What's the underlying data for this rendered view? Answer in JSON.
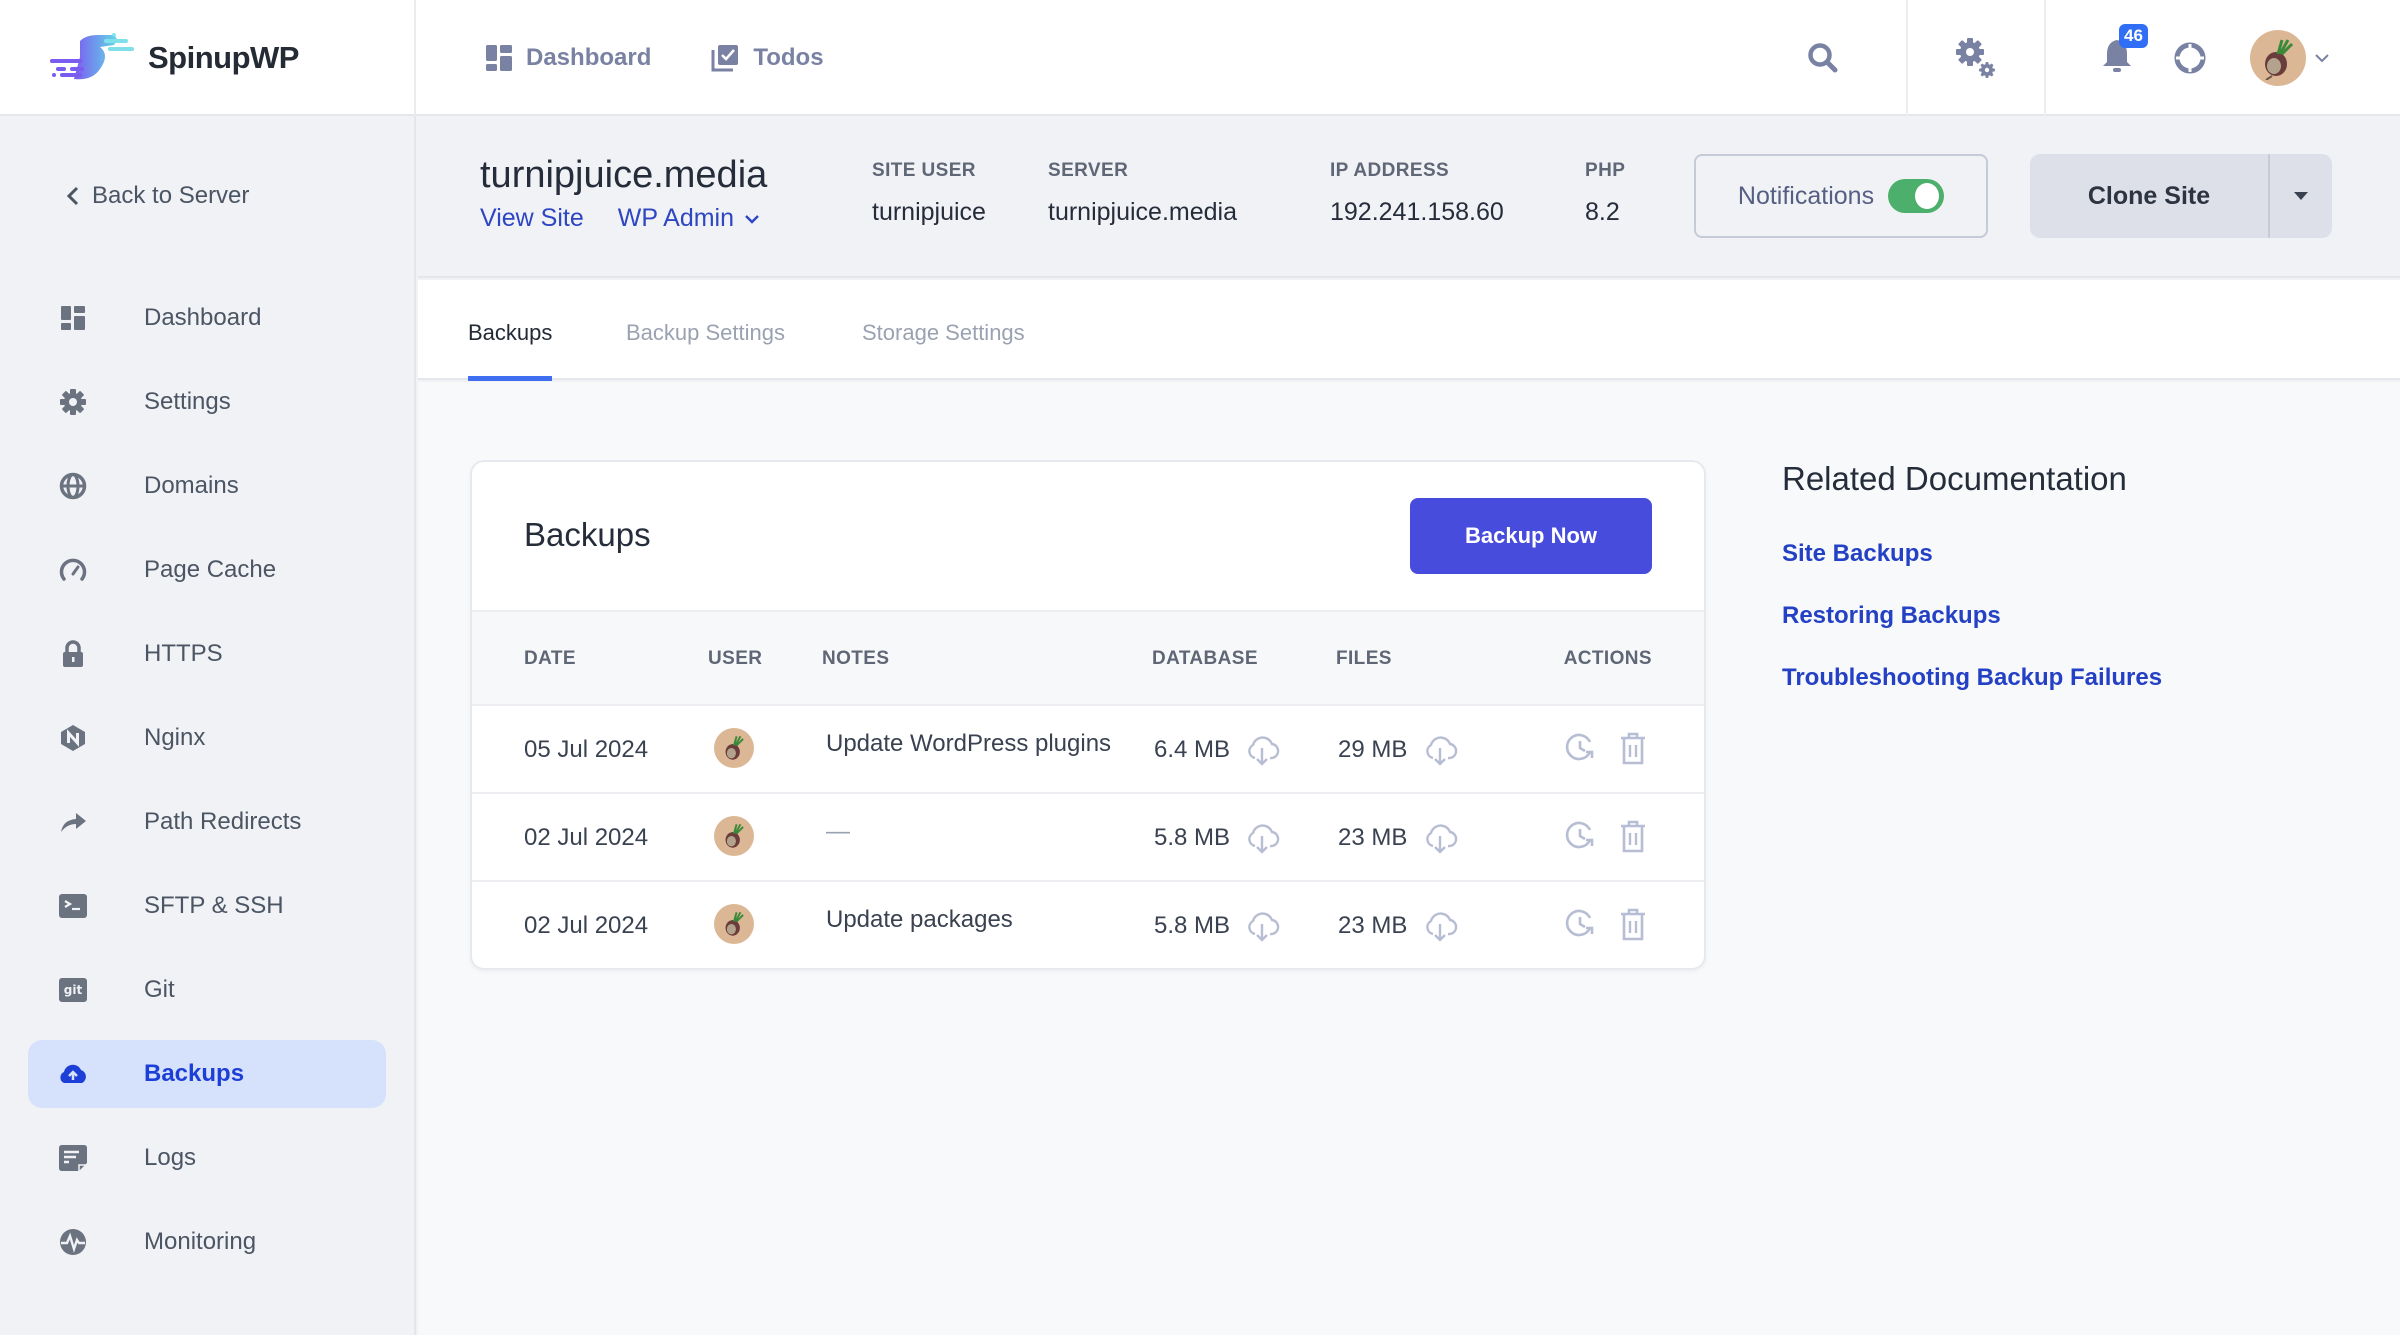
{
  "app": {
    "brand": "SpinupWP",
    "colors": {
      "accent": "#474cdc",
      "link": "#2440c4",
      "active_nav_bg": "#d6e1fb",
      "toggle_on": "#4caf6b",
      "badge": "#2f6ef5"
    }
  },
  "topnav": {
    "items": [
      {
        "label": "Dashboard",
        "icon": "dashboard-icon"
      },
      {
        "label": "Todos",
        "icon": "todos-icon"
      }
    ],
    "notifications_count": "46",
    "icons": [
      "search-icon",
      "gear-icon",
      "bell-icon",
      "help-icon",
      "avatar",
      "chevron-down-icon"
    ]
  },
  "sidebar": {
    "back_label": "Back to Server",
    "items": [
      {
        "label": "Dashboard",
        "icon": "dashboard-icon",
        "active": false
      },
      {
        "label": "Settings",
        "icon": "gear-icon",
        "active": false
      },
      {
        "label": "Domains",
        "icon": "globe-icon",
        "active": false
      },
      {
        "label": "Page Cache",
        "icon": "gauge-icon",
        "active": false
      },
      {
        "label": "HTTPS",
        "icon": "lock-icon",
        "active": false
      },
      {
        "label": "Nginx",
        "icon": "nginx-icon",
        "active": false
      },
      {
        "label": "Path Redirects",
        "icon": "redirect-icon",
        "active": false
      },
      {
        "label": "SFTP & SSH",
        "icon": "terminal-icon",
        "active": false
      },
      {
        "label": "Git",
        "icon": "git-icon",
        "active": false
      },
      {
        "label": "Backups",
        "icon": "cloud-upload-icon",
        "active": true
      },
      {
        "label": "Logs",
        "icon": "logs-icon",
        "active": false
      },
      {
        "label": "Monitoring",
        "icon": "monitoring-icon",
        "active": false
      }
    ]
  },
  "site": {
    "title": "turnipjuice.media",
    "view_site": "View Site",
    "wp_admin": "WP Admin",
    "meta": [
      {
        "label": "SITE USER",
        "value": "turnipjuice"
      },
      {
        "label": "SERVER",
        "value": "turnipjuice.media"
      },
      {
        "label": "IP ADDRESS",
        "value": "192.241.158.60"
      },
      {
        "label": "PHP",
        "value": "8.2"
      }
    ],
    "notifications_label": "Notifications",
    "notifications_enabled": true,
    "clone_label": "Clone Site"
  },
  "tabs": [
    {
      "label": "Backups",
      "active": true
    },
    {
      "label": "Backup Settings",
      "active": false
    },
    {
      "label": "Storage Settings",
      "active": false
    }
  ],
  "backups": {
    "title": "Backups",
    "backup_now": "Backup Now",
    "columns": [
      "DATE",
      "USER",
      "NOTES",
      "DATABASE",
      "FILES",
      "ACTIONS"
    ],
    "rows": [
      {
        "date": "05 Jul 2024",
        "notes": "Update WordPress plugins",
        "database": "6.4 MB",
        "files": "29 MB"
      },
      {
        "date": "02 Jul 2024",
        "notes": "—",
        "database": "5.8 MB",
        "files": "23 MB"
      },
      {
        "date": "02 Jul 2024",
        "notes": "Update packages",
        "database": "5.8 MB",
        "files": "23 MB"
      }
    ]
  },
  "related": {
    "title": "Related Documentation",
    "links": [
      "Site Backups",
      "Restoring Backups",
      "Troubleshooting Backup Failures"
    ]
  }
}
